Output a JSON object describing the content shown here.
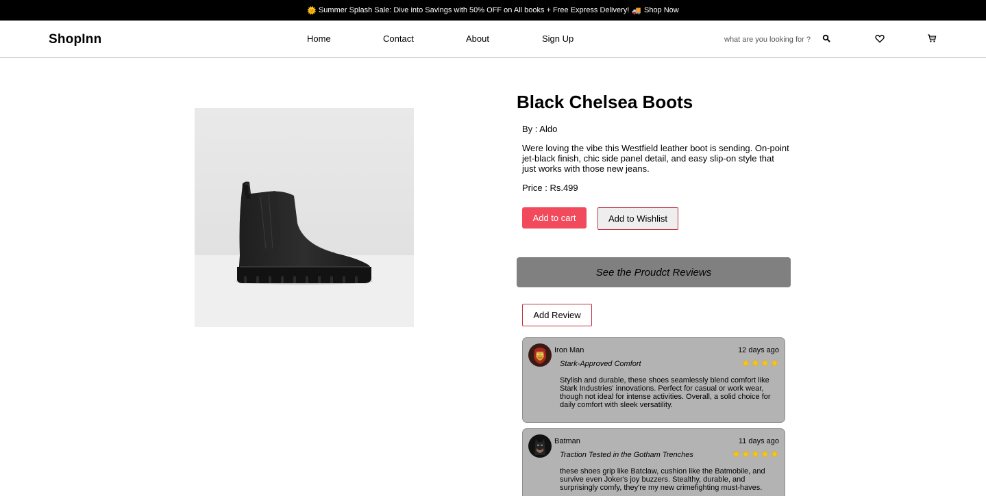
{
  "promo": {
    "emoji_sun": "🌞",
    "text": "Summer Splash Sale: Dive into Savings with 50% OFF on All books + Free Express Delivery!",
    "emoji_truck": "🚚",
    "link": "Shop Now"
  },
  "header": {
    "logo": "ShopInn",
    "nav": [
      "Home",
      "Contact",
      "About",
      "Sign Up"
    ],
    "search_placeholder": "what are you looking for ?",
    "icons": [
      "search-icon",
      "heart-icon",
      "cart-icon"
    ]
  },
  "product": {
    "image_icon": "chelsea-boot-image",
    "title": "Black Chelsea Boots",
    "byline": "By : Aldo",
    "description": "Were loving the vibe this Westfield leather boot is sending. On-point jet-black finish, chic side panel detail, and easy slip-on style that just works with those new jeans.",
    "price": "Price : Rs.499",
    "add_to_cart": "Add to cart",
    "add_to_wishlist": "Add to Wishlist"
  },
  "reviews": {
    "toggle_label": "See the Proudct Reviews",
    "add_review": "Add Review",
    "star_color": "#f5c518",
    "items": [
      {
        "name": "Iron Man",
        "time": "12 days ago",
        "title": "Stark-Approved Comfort",
        "stars": 4,
        "avatar_icon": "iron-man-avatar",
        "body": "Stylish and durable, these shoes seamlessly blend comfort like Stark Industries' innovations. Perfect for casual or work wear, though not ideal for intense activities. Overall, a solid choice for daily comfort with sleek versatility."
      },
      {
        "name": "Batman",
        "time": "11 days ago",
        "title": "Traction Tested in the Gotham Trenches",
        "stars": 5,
        "avatar_icon": "batman-avatar",
        "body": "these shoes grip like Batclaw, cushion like the Batmobile, and survive even Joker's joy buzzers. Stealthy, durable, and surprisingly comfy, they're my new crimefighting must-haves."
      }
    ]
  },
  "colors": {
    "promo_bg": "#000000",
    "primary_button": "#f04a5c",
    "review_card_bg": "#b3b3b3",
    "reviews_toggle_bg": "#808080"
  }
}
